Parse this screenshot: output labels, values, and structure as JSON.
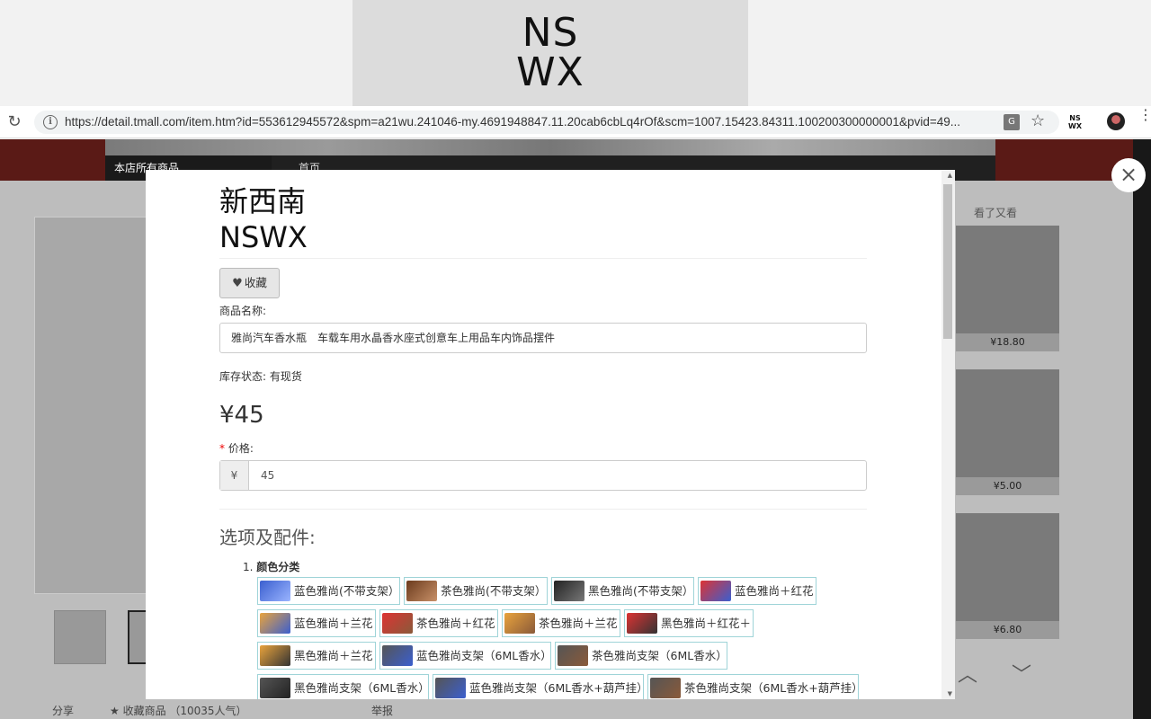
{
  "logo": {
    "line1": "NS",
    "line2": "WX"
  },
  "browser": {
    "url": "https://detail.tmall.com/item.htm?id=553612945572&spm=a21wu.241046-my.4691948847.11.20cab6cbLq4rOf&scm=1007.15423.84311.100200300000001&pvid=49...",
    "reload_glyph": "↻",
    "ext_label": "NS\nWX"
  },
  "page": {
    "nav_all": "本店所有商品",
    "nav_home": "首页",
    "share": "分享",
    "fav": "★ 收藏商品 （10035人气）",
    "report": "举报",
    "right_title": "看了又看",
    "rec_prices": [
      "¥18.80",
      "¥5.00",
      "¥6.80"
    ]
  },
  "modal": {
    "close_glyph": "×",
    "brand_cn": "新西南",
    "brand_en": "NSWX",
    "fav_label": "收藏",
    "name_label": "商品名称:",
    "name_value": "雅尚汽车香水瓶　车载车用水晶香水座式创意车上用品车内饰品摆件",
    "stock_label": "库存状态: 有现货",
    "price_big": "¥45",
    "price_label": "价格:",
    "required_mark": "*",
    "currency": "¥",
    "price_value": "45",
    "options_title": "选项及配件:",
    "group_num": "1.",
    "group_name": "颜色分类",
    "options": [
      "蓝色雅尚(不带支架）",
      "茶色雅尚(不带支架）",
      "黑色雅尚(不带支架）",
      "蓝色雅尚＋红花",
      "蓝色雅尚＋兰花",
      "茶色雅尚＋红花",
      "茶色雅尚＋兰花",
      "黑色雅尚＋红花＋",
      "黑色雅尚＋兰花",
      "蓝色雅尚支架（6ML香水）",
      "茶色雅尚支架（6ML香水）",
      "黑色雅尚支架（6ML香水）",
      "蓝色雅尚支架（6ML香水+葫芦挂）",
      "茶色雅尚支架（6ML香水+葫芦挂）"
    ]
  },
  "colors": {
    "chip_border": "#9fd4d8",
    "banner": "#5a1a16",
    "required": "#ee0000"
  }
}
